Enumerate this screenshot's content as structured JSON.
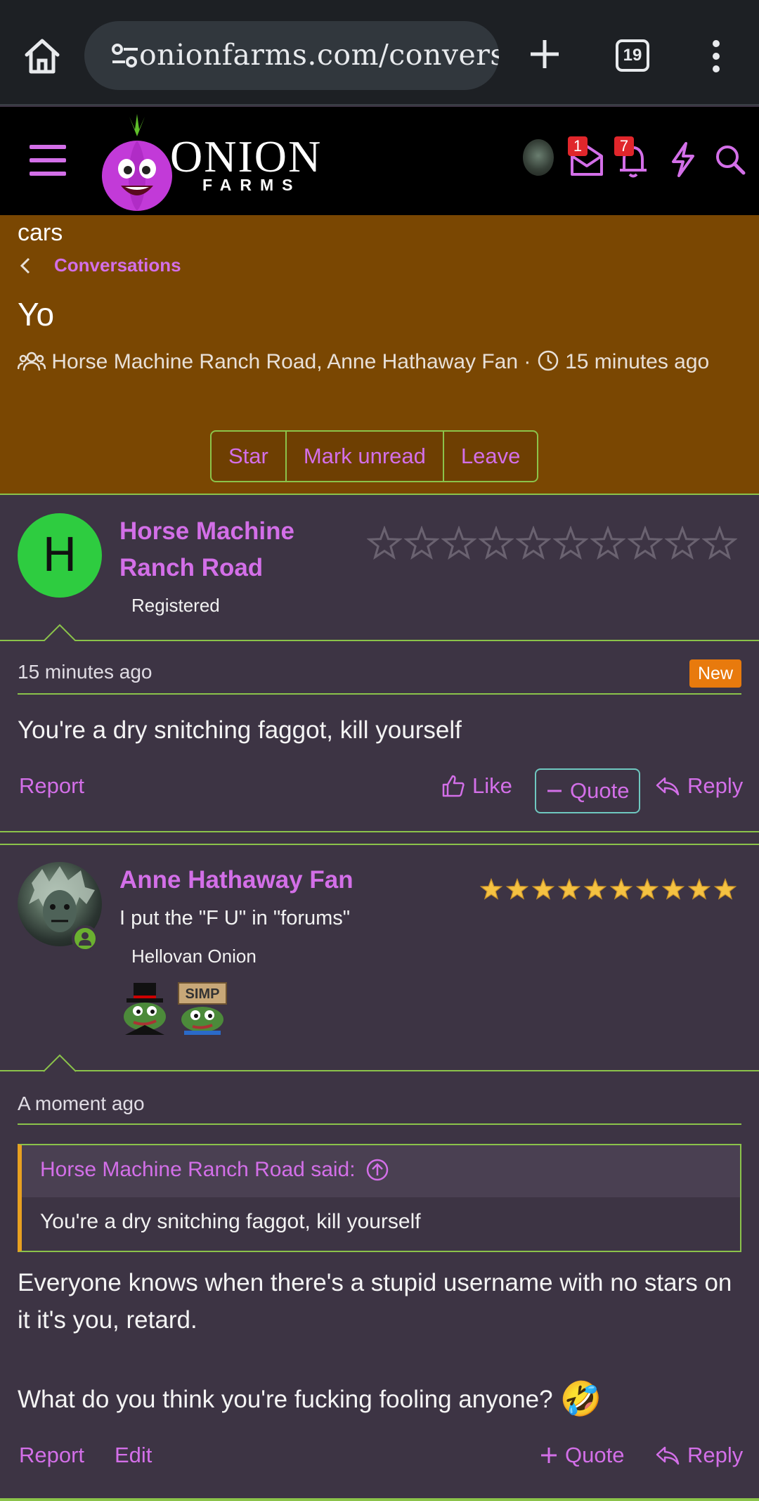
{
  "browser": {
    "url": "onionfarms.com/conversations",
    "tab_count": "19"
  },
  "site": {
    "logo_text": "ONION",
    "logo_sub": "FARMS",
    "inbox_badge": "1",
    "alerts_badge": "7"
  },
  "conversation": {
    "forum_tail": "cars",
    "breadcrumb": "Conversations",
    "title": "Yo",
    "participants": "Horse Machine Ranch Road, Anne Hathaway Fan",
    "separator": "·",
    "time": "15 minutes ago",
    "buttons": {
      "star": "Star",
      "mark_unread": "Mark unread",
      "leave": "Leave"
    }
  },
  "messages": [
    {
      "avatar_letter": "H",
      "username_line1": "Horse Machine",
      "username_line2": "Ranch Road",
      "banner": "Registered",
      "stars_filled": 0,
      "date": "15 minutes ago",
      "new_label": "New",
      "body": "You're a dry snitching faggot, kill yourself",
      "actions": {
        "report": "Report",
        "like": "Like",
        "quote": "Quote",
        "reply": "Reply"
      }
    },
    {
      "username": "Anne Hathaway Fan",
      "user_title": "I put the \"F U\" in \"forums\"",
      "banner": "Hellovan Onion",
      "stars_filled": 10,
      "badge_sign": "SIMP",
      "date": "A moment ago",
      "quote_attribution": "Horse Machine Ranch Road said:",
      "quote_text": "You're a dry snitching faggot, kill yourself",
      "body_line1": "Everyone knows when there's a stupid username with no stars on it it's you, retard.",
      "body_line2": "What do you think you're fucking fooling anyone?",
      "emoji": "🤣",
      "actions": {
        "report": "Report",
        "edit": "Edit",
        "quote": "Quote",
        "reply": "Reply"
      }
    }
  ],
  "colors": {
    "accent": "#d36fe8",
    "border_green": "#8bc34a",
    "header_orange": "#7a4702",
    "page_bg": "#3d3444",
    "new_badge": "#e87a0d",
    "star_gold": "#f5c242"
  }
}
